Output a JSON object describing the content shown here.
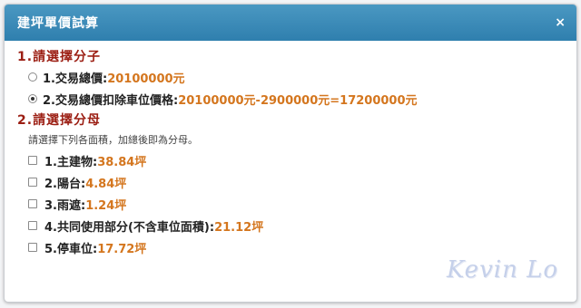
{
  "dialog": {
    "title": "建坪單價試算",
    "close_label": "×"
  },
  "numerator": {
    "heading_num": "1.",
    "heading": "請選擇分子",
    "options": [
      {
        "label": "1.交易總價:",
        "value": "20100000元",
        "selected": false
      },
      {
        "label": "2.交易總價扣除車位價格:",
        "value": "20100000元-2900000元=17200000元",
        "selected": true
      }
    ]
  },
  "denominator": {
    "heading_num": "2.",
    "heading": "請選擇分母",
    "hint": "請選擇下列各面積，加總後即為分母。",
    "items": [
      {
        "label": "1.主建物:",
        "value": "38.84坪"
      },
      {
        "label": "2.陽台:",
        "value": "4.84坪"
      },
      {
        "label": "3.雨遮:",
        "value": "1.24坪"
      },
      {
        "label": "4.共同使用部分(不含車位面積):",
        "value": "21.12坪"
      },
      {
        "label": "5.停車位:",
        "value": "17.72坪"
      }
    ]
  },
  "watermark": "Kevin Lo",
  "colors": {
    "title_bar": "#3b8cbb",
    "heading": "#9b1d12",
    "value": "#d4761e"
  }
}
